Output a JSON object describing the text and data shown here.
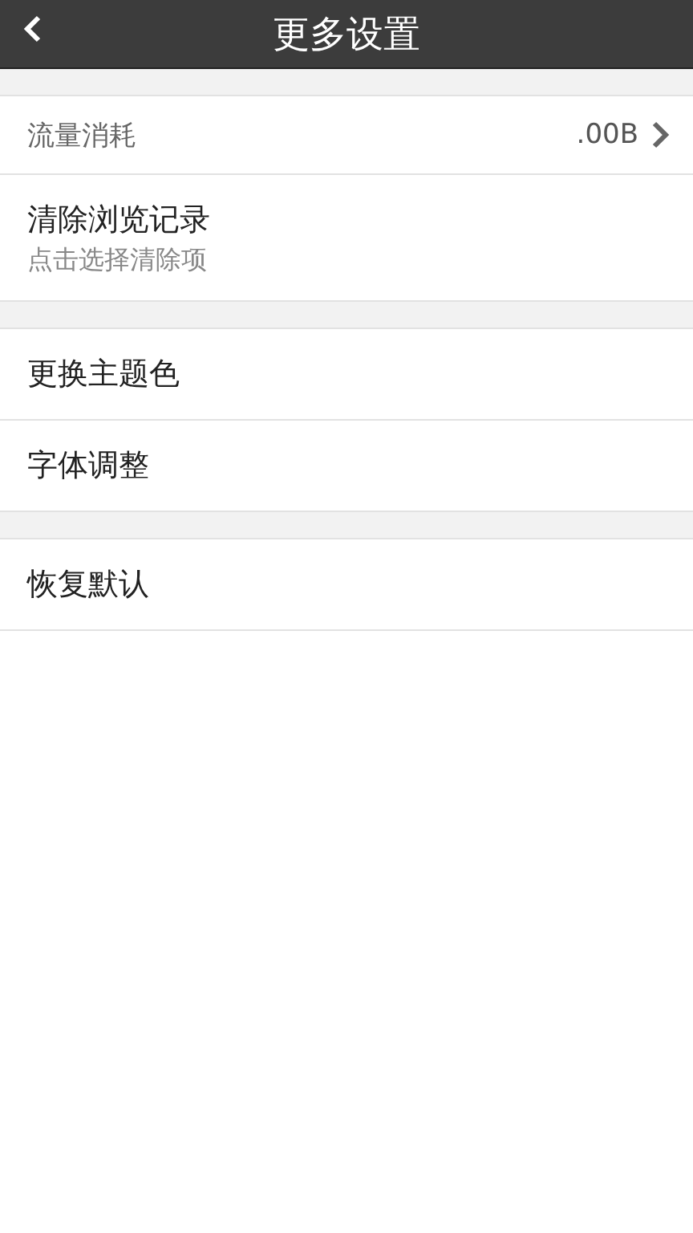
{
  "header": {
    "title": "更多设置"
  },
  "groups": [
    {
      "items": [
        {
          "kind": "value",
          "label": "流量消耗",
          "value": ".00B"
        },
        {
          "kind": "subtitle",
          "label": "清除浏览记录",
          "subtitle": "点击选择清除项"
        }
      ]
    },
    {
      "items": [
        {
          "kind": "plain",
          "label": "更换主题色"
        },
        {
          "kind": "plain",
          "label": "字体调整"
        }
      ]
    },
    {
      "items": [
        {
          "kind": "plain",
          "label": "恢复默认"
        }
      ]
    }
  ]
}
